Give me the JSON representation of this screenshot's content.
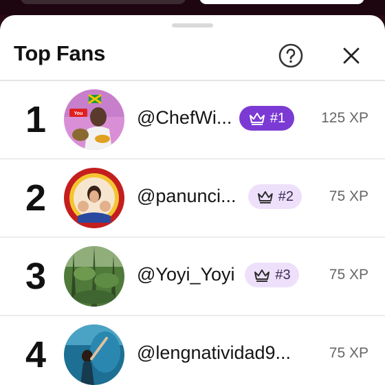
{
  "sheet": {
    "title": "Top Fans"
  },
  "fans": [
    {
      "rank": "1",
      "username": "@ChefWi...",
      "badge": "#1",
      "xp": "125 XP",
      "avatar": "chef-avatar"
    },
    {
      "rank": "2",
      "username": "@panunci...",
      "badge": "#2",
      "xp": "75 XP",
      "avatar": "family-avatar"
    },
    {
      "rank": "3",
      "username": "@Yoyi_Yoyi",
      "badge": "#3",
      "xp": "75 XP",
      "avatar": "jungle-avatar"
    },
    {
      "rank": "4",
      "username": "@lengnatividad9...",
      "badge": "",
      "xp": "75 XP",
      "avatar": "aquarium-avatar"
    }
  ],
  "colors": {
    "accent": "#7c3ad4",
    "badge_pale": "#eee0fb",
    "background": "#ffffff"
  },
  "icons": {
    "help": "help-circle-icon",
    "close": "close-icon",
    "crown": "crown-icon"
  }
}
